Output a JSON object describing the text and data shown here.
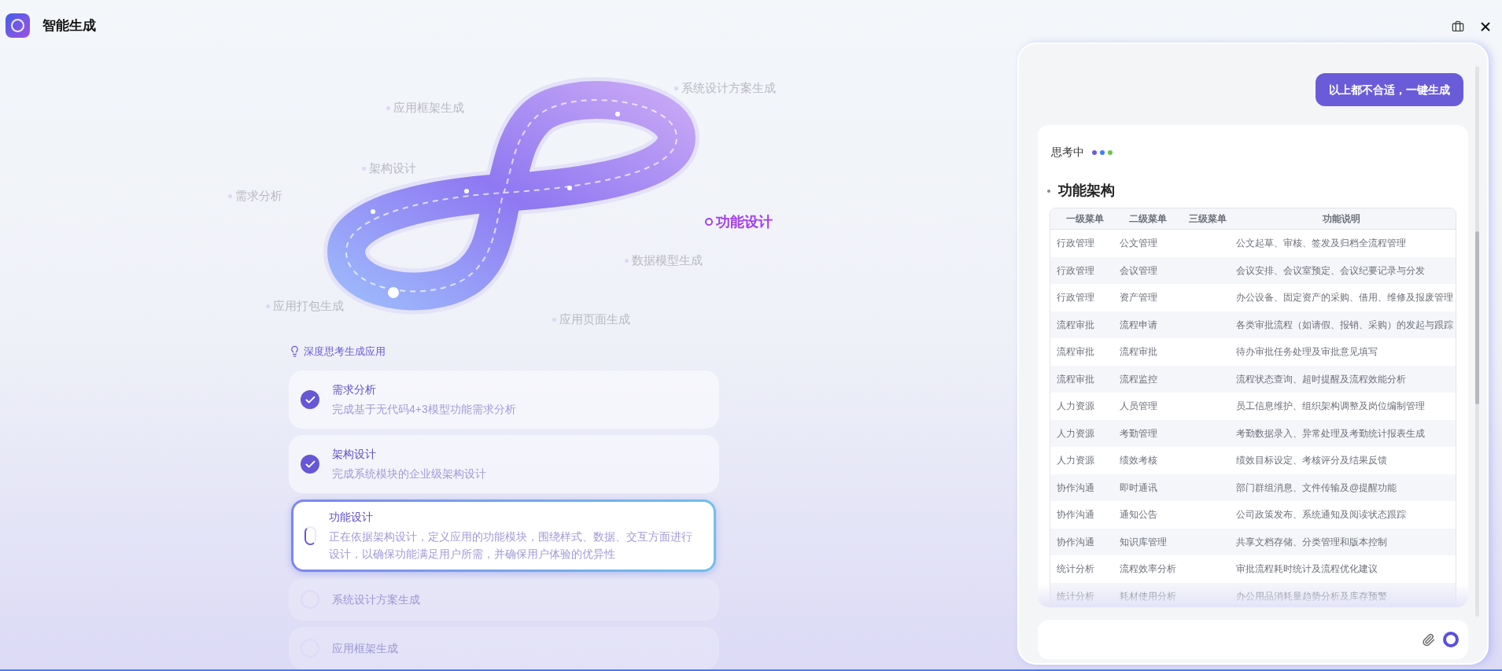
{
  "window": {
    "title": "智能生成"
  },
  "diagram": {
    "stages": [
      {
        "label": "系统设计方案生成",
        "selected": false
      },
      {
        "label": "应用框架生成",
        "selected": false
      },
      {
        "label": "架构设计",
        "selected": false
      },
      {
        "label": "需求分析",
        "selected": false
      },
      {
        "label": "功能设计",
        "selected": true
      },
      {
        "label": "数据模型生成",
        "selected": false
      },
      {
        "label": "应用打包生成",
        "selected": false
      },
      {
        "label": "应用页面生成",
        "selected": false
      }
    ]
  },
  "steps_header": "深度思考生成应用",
  "steps": [
    {
      "kind": "done",
      "title": "需求分析",
      "description": "完成基于无代码4+3模型功能需求分析"
    },
    {
      "kind": "done",
      "title": "架构设计",
      "description": "完成系统模块的企业级架构设计"
    },
    {
      "kind": "active",
      "title": "功能设计",
      "description": "正在依据架构设计，定义应用的功能模块，围绕样式、数据、交互方面进行设计，以确保功能满足用户所需，并确保用户体验的优异性"
    },
    {
      "kind": "pending",
      "title": "系统设计方案生成"
    },
    {
      "kind": "pending",
      "title": "应用框架生成"
    }
  ],
  "chat": {
    "suggestion_button": "以上都不合适，一键生成",
    "status": "思考中",
    "heading": "功能架构",
    "table": {
      "columns": [
        "一级菜单",
        "二级菜单",
        "三级菜单",
        "功能说明"
      ],
      "rows": [
        {
          "level_1": "行政管理",
          "level_2": "公文管理",
          "description": "公文起草、审核、签发及归档全流程管理"
        },
        {
          "level_1": "行政管理",
          "level_2": "会议管理",
          "description": "会议安排、会议室预定、会议纪要记录与分发"
        },
        {
          "level_1": "行政管理",
          "level_2": "资产管理",
          "description": "办公设备、固定资产的采购、借用、维修及报废管理"
        },
        {
          "level_1": "流程审批",
          "level_2": "流程申请",
          "description": "各类审批流程（如请假、报销、采购）的发起与跟踪"
        },
        {
          "level_1": "流程审批",
          "level_2": "流程审批",
          "description": "待办审批任务处理及审批意见填写"
        },
        {
          "level_1": "流程审批",
          "level_2": "流程监控",
          "description": "流程状态查询、超时提醒及流程效能分析"
        },
        {
          "level_1": "人力资源",
          "level_2": "人员管理",
          "description": "员工信息维护、组织架构调整及岗位编制管理"
        },
        {
          "level_1": "人力资源",
          "level_2": "考勤管理",
          "description": "考勤数据录入、异常处理及考勤统计报表生成"
        },
        {
          "level_1": "人力资源",
          "level_2": "绩效考核",
          "description": "绩效目标设定、考核评分及结果反馈"
        },
        {
          "level_1": "协作沟通",
          "level_2": "即时通讯",
          "description": "部门群组消息、文件传输及@提醒功能"
        },
        {
          "level_1": "协作沟通",
          "level_2": "通知公告",
          "description": "公司政策发布、系统通知及阅读状态跟踪"
        },
        {
          "level_1": "协作沟通",
          "level_2": "知识库管理",
          "description": "共享文档存储、分类管理和版本控制"
        },
        {
          "level_1": "统计分析",
          "level_2": "流程效率分析",
          "description": "审批流程耗时统计及流程优化建议"
        },
        {
          "level_1": "统计分析",
          "level_2": "耗材使用分析",
          "description": "办公用品消耗量趋势分析及库存预警"
        }
      ]
    }
  }
}
